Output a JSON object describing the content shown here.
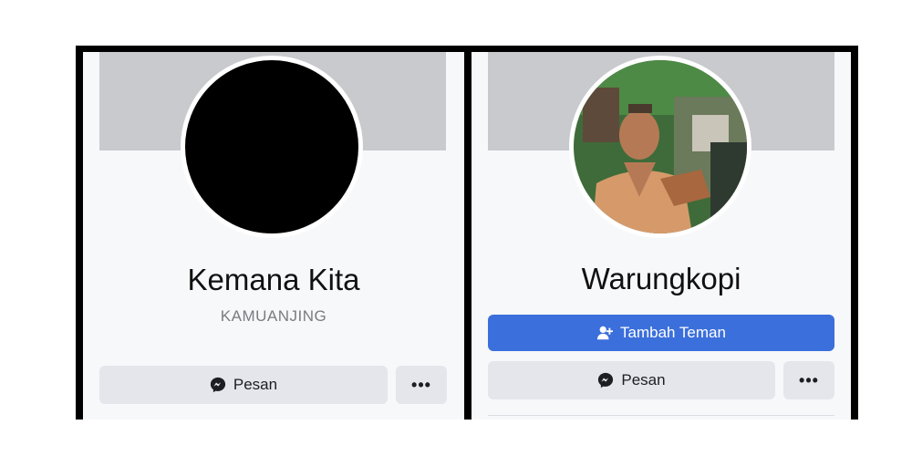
{
  "profiles": [
    {
      "name": "Kemana Kita",
      "subname": "KAMUANJING",
      "message_label": "Pesan",
      "more_label": "•••"
    },
    {
      "name": "Warungkopi",
      "add_friend_label": "Tambah Teman",
      "message_label": "Pesan",
      "more_label": "•••"
    }
  ],
  "colors": {
    "frame": "#000000",
    "panel_bg": "#f7f8fa",
    "cover": "#c9cacd",
    "button_gray": "#e4e6eb",
    "button_primary": "#3b6fdb"
  },
  "icons": {
    "messenger": "messenger-icon",
    "add_friend": "add-friend-icon",
    "more": "more-dots-icon"
  }
}
